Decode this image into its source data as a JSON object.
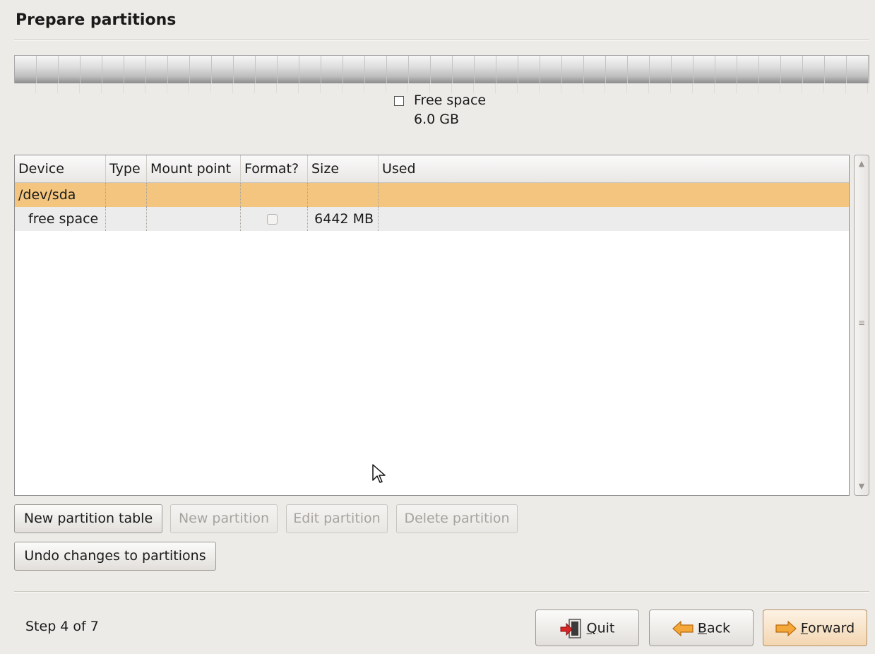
{
  "page": {
    "title": "Prepare partitions"
  },
  "disk_legend": {
    "label": "Free space",
    "size": "6.0 GB"
  },
  "table": {
    "columns": [
      "Device",
      "Type",
      "Mount point",
      "Format?",
      "Size",
      "Used"
    ],
    "rows": [
      {
        "device": "/dev/sda",
        "type": "",
        "mount": "",
        "format": null,
        "size": "",
        "used": "",
        "selected": true
      },
      {
        "device": "free space",
        "type": "",
        "mount": "",
        "format": false,
        "size": "6442 MB",
        "used": "",
        "selected": false
      }
    ]
  },
  "buttons": {
    "new_table": "New partition table",
    "new_partition": "New partition",
    "edit_partition": "Edit partition",
    "delete_partition": "Delete partition",
    "undo": "Undo changes to partitions"
  },
  "footer": {
    "step": "Step 4 of 7",
    "quit": {
      "mnemonic": "Q",
      "rest": "uit"
    },
    "back": {
      "mnemonic": "B",
      "rest": "ack"
    },
    "forward": {
      "mnemonic": "F",
      "rest": "orward"
    }
  },
  "icons": {
    "quit": "quit-exit-door-icon",
    "back": "back-arrow-icon",
    "forward": "forward-arrow-icon",
    "cursor": "mouse-pointer-icon"
  },
  "colors": {
    "selected_row": "#f3c57f",
    "alt_row": "#ececec",
    "window_bg": "#edebe8",
    "arrow_orange": "#f5a83a"
  }
}
